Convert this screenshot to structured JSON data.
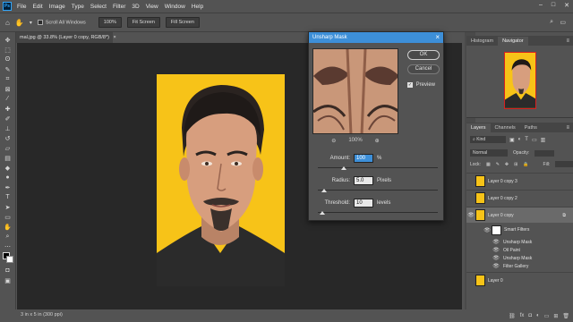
{
  "app": {
    "logo": "Ps",
    "menus": [
      "File",
      "Edit",
      "Image",
      "Type",
      "Select",
      "Filter",
      "3D",
      "View",
      "Window",
      "Help"
    ]
  },
  "options_bar": {
    "scroll_all_windows": "Scroll All Windows",
    "zoom_100": "100%",
    "fit_screen": "Fit Screen",
    "fill_screen": "Fill Screen"
  },
  "document": {
    "tab_title": "mal.jpg @ 33.8% (Layer 0 copy, RGB/8*)",
    "status": "3 in x 5 in (300 ppi)"
  },
  "dialog": {
    "title": "Unsharp Mask",
    "ok_label": "OK",
    "cancel_label": "Cancel",
    "preview_label": "Preview",
    "zoom_level": "100%",
    "amount_label": "Amount:",
    "amount_value": "100",
    "amount_unit": "%",
    "radius_label": "Radius:",
    "radius_value": "5.0",
    "radius_unit": "Pixels",
    "threshold_label": "Threshold:",
    "threshold_value": "10",
    "threshold_unit": "levels",
    "amount_slider_fraction": 0.22,
    "radius_slider_fraction": 0.05,
    "threshold_slider_fraction": 0.04
  },
  "navigator": {
    "tabs": [
      "Histogram",
      "Navigator"
    ]
  },
  "layers": {
    "tabs": [
      "Layers",
      "Channels",
      "Paths"
    ],
    "kind_filter": "Kind",
    "blend_mode": "Normal",
    "opacity_label": "Opacity:",
    "lock_label": "Lock:",
    "fill_label": "Fill:",
    "rows": [
      {
        "name": "Layer 0 copy 3"
      },
      {
        "name": "Layer 0 copy 2"
      },
      {
        "name": "Layer 0 copy"
      },
      {
        "name": "Smart Filters"
      },
      {
        "name": "Unsharp Mask"
      },
      {
        "name": "Oil Paint"
      },
      {
        "name": "Unsharp Mask"
      },
      {
        "name": "Filter Gallery"
      },
      {
        "name": "Layer 0"
      }
    ]
  },
  "colors": {
    "photo_bg": "#f7c318",
    "dialog_title_bar": "#3d8fd8",
    "canvas": "#282828"
  }
}
